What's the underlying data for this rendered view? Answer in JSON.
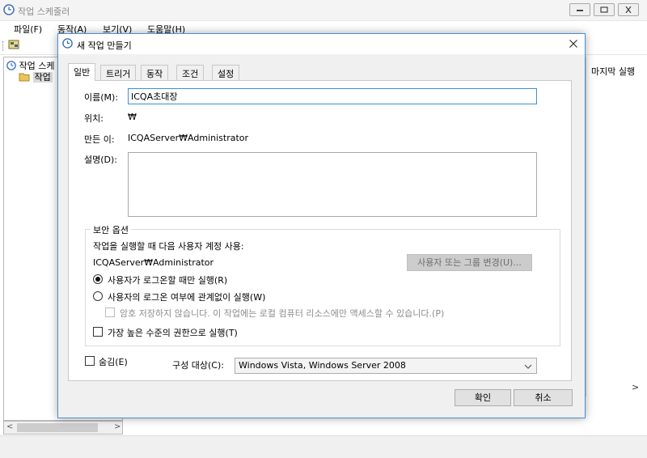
{
  "main_window": {
    "title": "작업 스케줄러",
    "menu": [
      "파일(F)",
      "동작(A)",
      "보기(V)",
      "도움말(H)"
    ],
    "tree": {
      "root_label": "작업 스케",
      "child_label": "작업"
    },
    "column_last_run": "마지막 실행"
  },
  "dialog": {
    "title": "새 작업 만들기",
    "tabs": [
      "일반",
      "트리거",
      "동작",
      "조건",
      "설정"
    ],
    "general": {
      "name_label": "이름(M):",
      "name_value": "ICQA초대장",
      "location_label": "위치:",
      "location_value": "₩",
      "author_label": "만든 이:",
      "author_value": "ICQAServer₩Administrator",
      "description_label": "설명(D):",
      "description_value": ""
    },
    "security": {
      "legend": "보안 옵션",
      "run_as_label": "작업을 실행할 때 다음 사용자 계정 사용:",
      "run_as_user": "ICQAServer₩Administrator",
      "change_user_button": "사용자 또는 그룹 변경(U)...",
      "radio_logged_on": "사용자가 로그온할 때만 실행(R)",
      "radio_whether_logged": "사용자의 로그온 여부에 관계없이 실행(W)",
      "no_store_password": "암호 저장하지 않습니다. 이 작업에는 로컬 컴퓨터 리소스에만 액세스할 수 있습니다.(P)",
      "highest_privileges": "가장 높은 수준의 권한으로 실행(T)"
    },
    "hidden_label": "숨김(E)",
    "configure_label": "구성 대상(C):",
    "configure_value": "Windows Vista, Windows Server 2008",
    "ok_button": "확인",
    "cancel_button": "취소"
  }
}
